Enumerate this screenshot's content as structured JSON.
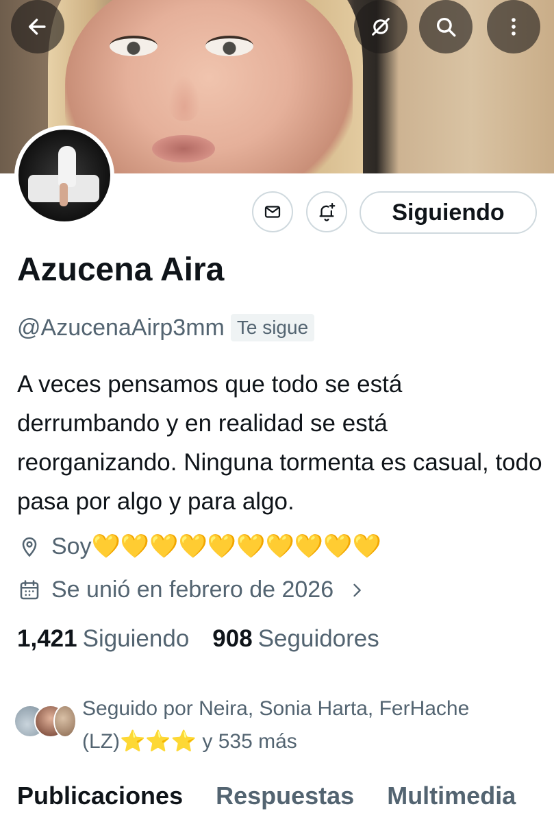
{
  "header": {
    "back_icon": "arrow-left-icon",
    "mute_icon": "eye-slash-icon",
    "search_icon": "search-icon",
    "more_icon": "more-vertical-icon"
  },
  "profile": {
    "name": "Azucena Aira",
    "handle": "@AzucenaAirp3mm",
    "follows_you_label": "Te sigue",
    "bio": "A veces pensamos que todo se está derrumbando y en realidad se está reorganizando. Ninguna tormenta es casual, todo pasa por algo y para algo.",
    "location": "Soy💛💛💛💛💛💛💛💛💛💛",
    "joined": "Se unió en febrero de 2026"
  },
  "actions": {
    "message_icon": "mail-icon",
    "notify_icon": "bell-plus-icon",
    "follow_label": "Siguiendo"
  },
  "stats": {
    "following_count": "1,421",
    "following_label": "Siguiendo",
    "followers_count": "908",
    "followers_label": "Seguidores"
  },
  "followed_by": {
    "text": "Seguido por Neira, Sonia Harta, FerHache (LZ)⭐⭐⭐ y 535 más"
  },
  "tabs": [
    {
      "label": "Publicaciones",
      "active": true
    },
    {
      "label": "Respuestas",
      "active": false
    },
    {
      "label": "Multimedia",
      "active": false
    }
  ],
  "colors": {
    "text_primary": "#0f1419",
    "text_secondary": "#536471",
    "border": "#cfd9de"
  }
}
